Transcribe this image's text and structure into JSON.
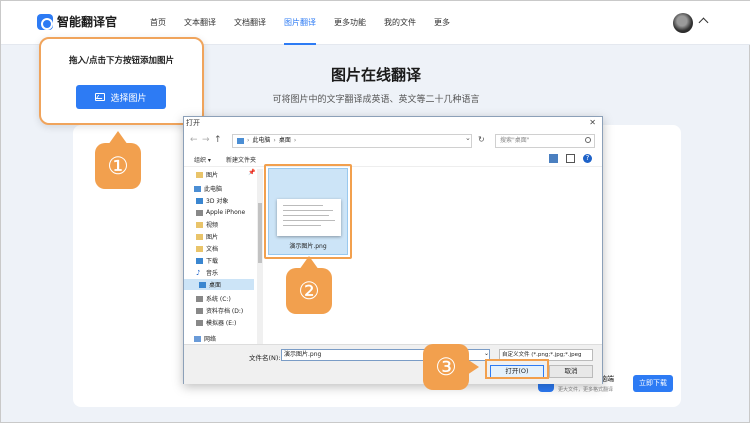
{
  "app": {
    "name": "智能翻译官"
  },
  "nav": {
    "items": [
      {
        "label": "首页",
        "active": false
      },
      {
        "label": "文本翻译",
        "active": false
      },
      {
        "label": "文档翻译",
        "active": false
      },
      {
        "label": "图片翻译",
        "active": true
      },
      {
        "label": "更多功能",
        "active": false
      },
      {
        "label": "我的文件",
        "active": false
      },
      {
        "label": "更多",
        "active": false
      }
    ]
  },
  "page": {
    "title": "图片在线翻译",
    "subtitle": "可将图片中的文字翻译成英语、英文等二十几种语言"
  },
  "popup": {
    "text": "拖入/点击下方按钮添加图片",
    "button_label": "选择图片"
  },
  "badges": {
    "one": "①",
    "two": "②",
    "three": "③"
  },
  "promo": {
    "title": "智能翻译官电脑端",
    "subtitle": "更大文件，更多格式翻译",
    "button_label": "立即下载"
  },
  "dialog": {
    "title": "打开",
    "close": "✕",
    "address": {
      "parts": [
        "此电脑",
        "桌面"
      ]
    },
    "search_placeholder": "搜索\"桌面\"",
    "toolbar": {
      "organize": "组织 ▾",
      "new_folder": "新建文件夹"
    },
    "tree": {
      "quick_item": "图片",
      "this_pc": "此电脑",
      "items": [
        "3D 对象",
        "Apple iPhone",
        "视频",
        "图片",
        "文档",
        "下载",
        "音乐",
        "桌面",
        "系统 (C:)",
        "资料存档 (D:)",
        "模拟器 (E:)"
      ],
      "network": "网络"
    },
    "file": {
      "name": "演示图片.png"
    },
    "filename_label": "文件名(N):",
    "filename_value": "演示图片.png",
    "filetype": "自定义文件 (*.png;*.jpg;*.jpeg",
    "open_label": "打开(O)",
    "cancel_label": "取消"
  },
  "colors": {
    "accent": "#2d7bf4",
    "callout": "#f2a04e"
  }
}
